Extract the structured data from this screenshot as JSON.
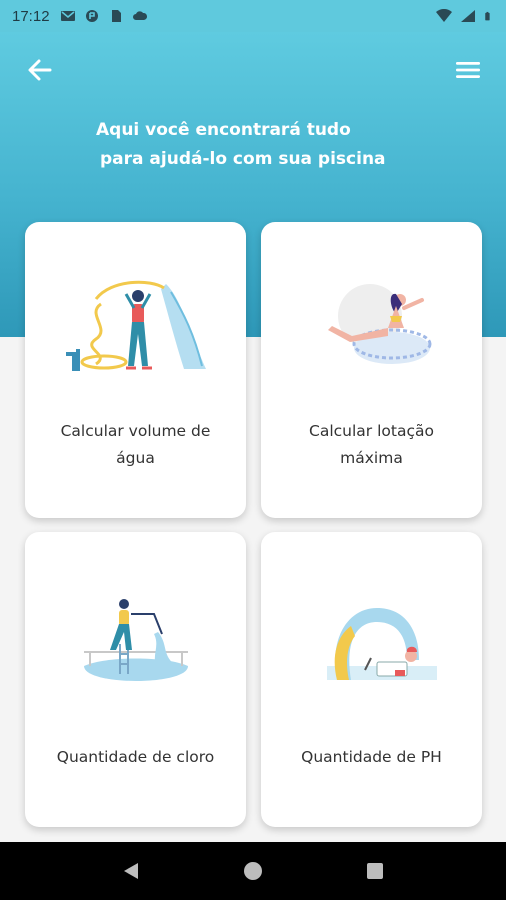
{
  "status_bar": {
    "time": "17:12",
    "left_icons": [
      "gmail-icon",
      "app-icon",
      "sim-icon",
      "cloud-icon"
    ],
    "right_icons": [
      "wifi-icon",
      "signal-icon",
      "battery-icon"
    ]
  },
  "header": {
    "back_icon": "arrow-left-icon",
    "menu_icon": "hamburger-menu-icon",
    "headline_line1": "Aqui você encontrará tudo",
    "headline_line2": "para ajudá-lo com sua piscina"
  },
  "cards": [
    {
      "id": "volume",
      "label": "Calcular volume de água",
      "illustration": "hose-worker-illustration"
    },
    {
      "id": "lotacao",
      "label": "Calcular lotação máxima",
      "illustration": "woman-float-illustration"
    },
    {
      "id": "cloro",
      "label": "Quantidade de cloro",
      "illustration": "pool-cleaner-illustration"
    },
    {
      "id": "ph",
      "label": "Quantidade de PH",
      "illustration": "ph-test-illustration"
    }
  ],
  "colors": {
    "hero_top": "#5fcbe0",
    "hero_bottom": "#2e98b8",
    "card_bg": "#ffffff",
    "page_bg": "#f4f4f4"
  },
  "nav_bar": {
    "icons": [
      "back-triangle-icon",
      "home-circle-icon",
      "recents-square-icon"
    ]
  }
}
